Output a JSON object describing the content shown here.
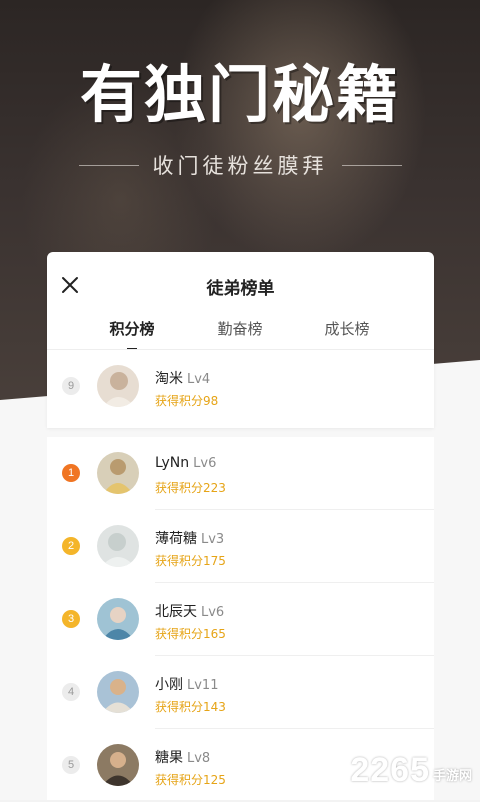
{
  "hero": {
    "title": "有独门秘籍",
    "subtitle": "收门徒粉丝膜拜"
  },
  "card": {
    "title": "徒弟榜单",
    "tabs": [
      {
        "label": "积分榜",
        "active": true
      },
      {
        "label": "勤奋榜",
        "active": false
      },
      {
        "label": "成长榜",
        "active": false
      }
    ]
  },
  "my_rank": {
    "rank": "9",
    "name": "淘米",
    "level": "Lv4",
    "score": "获得积分98"
  },
  "ranking": [
    {
      "rank": "1",
      "name": "LyNn",
      "level": "Lv6",
      "score": "获得积分223"
    },
    {
      "rank": "2",
      "name": "薄荷糖",
      "level": "Lv3",
      "score": "获得积分175"
    },
    {
      "rank": "3",
      "name": "北辰天",
      "level": "Lv6",
      "score": "获得积分165"
    },
    {
      "rank": "4",
      "name": "小刚",
      "level": "Lv11",
      "score": "获得积分143"
    },
    {
      "rank": "5",
      "name": "糖果",
      "level": "Lv8",
      "score": "获得积分125"
    }
  ],
  "watermark": {
    "number": "2265",
    "site": "手游网"
  },
  "colors": {
    "accent": "#e6a417",
    "rank1": "#f07523",
    "rank23": "#f4b52a"
  }
}
